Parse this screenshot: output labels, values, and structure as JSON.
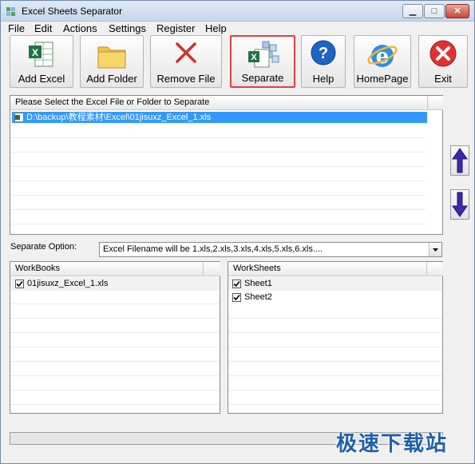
{
  "window": {
    "title": "Excel Sheets Separator"
  },
  "menu": [
    "File",
    "Edit",
    "Actions",
    "Settings",
    "Register",
    "Help"
  ],
  "toolbar": [
    {
      "label": "Add Excel",
      "icon": "excel-add-icon"
    },
    {
      "label": "Add Folder",
      "icon": "folder-icon"
    },
    {
      "label": "Remove File",
      "icon": "remove-x-icon"
    },
    {
      "label": "Separate",
      "icon": "separate-icon"
    },
    {
      "label": "Help",
      "icon": "help-icon"
    },
    {
      "label": "HomePage",
      "icon": "browser-icon"
    },
    {
      "label": "Exit",
      "icon": "exit-icon"
    }
  ],
  "file_list": {
    "header": "Please Select the Excel File or Folder to Separate",
    "items": [
      "D:\\backup\\教程素材\\Excel\\01jisuxz_Excel_1.xls"
    ]
  },
  "separate_option": {
    "label": "Separate Option:",
    "selected": "Excel Filename will be 1.xls,2.xls,3.xls,4.xls,5.xls,6.xls...."
  },
  "workbooks": {
    "header": "WorkBooks",
    "items": [
      {
        "name": "01jisuxz_Excel_1.xls",
        "checked": true
      }
    ]
  },
  "worksheets": {
    "header": "WorkSheets",
    "items": [
      {
        "name": "Sheet1",
        "checked": true
      },
      {
        "name": "Sheet2",
        "checked": true
      }
    ]
  },
  "watermark": "极速下载站",
  "colors": {
    "selection": "#3399ff",
    "highlight_border": "#e04040",
    "accent_blue": "#1f5fa8"
  }
}
